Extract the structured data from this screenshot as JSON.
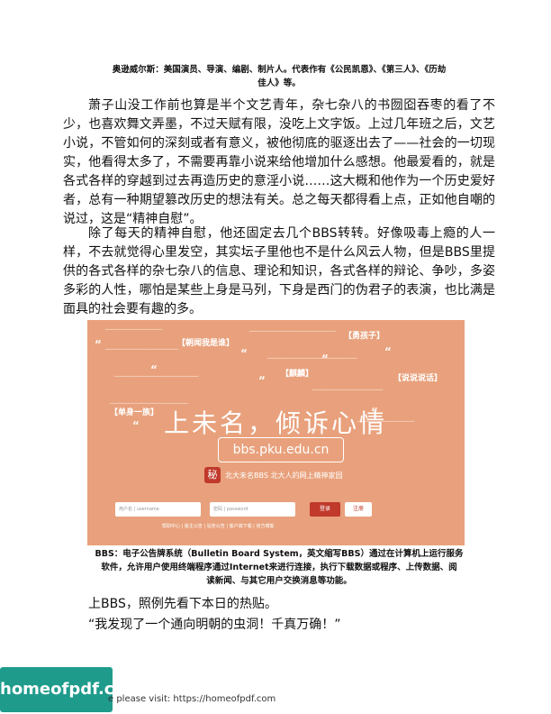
{
  "caption_top": {
    "line1": "奥逊威尔斯：美国演员、导演、编剧、制片人。代表作有《公民凯恩》、《第三人》、《历劫",
    "line2": "佳人》等。"
  },
  "paragraphs": [
    "萧子山没工作前也算是半个文艺青年，杂七杂八的书囫囵吞枣的看了不少，也喜欢舞文弄墨，不过天赋有限，没吃上文字饭。上过几年班之后，文艺小说，不管如何的深刻或者有意义，被他彻底的驱逐出去了——社会的一切现实，他看得太多了，不需要再靠小说来给他增加什么感想。他最爱看的，就是各式各样的穿越到过去再造历史的意淫小说……这大概和他作为一个历史爱好者，总有一种期望篡改历史的想法有关。总之每天都得看上点，正如他自嘲的说过，这是“精神自慰”。",
    "除了每天的精神自慰，他还固定去几个BBS转转。好像吸毒上瘾的人一样，不去就觉得心里发空，其实坛子里他也不是什么风云人物，但是BBS里提供的各式各样的杂七杂八的信息、理论和知识，各式各样的辩论、争吵，多姿多彩的人性，哪怕是某些上身是马列，下身是西门的伪君子的表演，也比满是面具的社会要有趣的多。"
  ],
  "banner": {
    "tags": [
      "【朝闻我是谁】",
      "【勇孩子】",
      "【麒麟】",
      "【说说说话】",
      "【单身一族】"
    ],
    "slogan": "上未名，倾诉心情",
    "url": "bbs.pku.edu.cn",
    "logo_char": "秘",
    "subtitle": "北大未名BBS 北大人的网上精神家园",
    "username_placeholder": "用户名 | username",
    "password_placeholder": "密码 | password",
    "login_label": "登录",
    "register_label": "注册",
    "links": "帮助中心 | 版主公告 | 站务公告 | 客户端下载 | 官方博客"
  },
  "caption_bottom": {
    "line1": "BBS：电子公告牌系统（Bulletin Board System，英文缩写BBS）通过在计算机上运行服务",
    "line2": "软件，允许用户使用终端程序通过Internet来进行连接，执行下载数据或程序、上传数据、阅",
    "line3": "读新闻、与其它用户交换消息等功能。"
  },
  "lines_after": {
    "line1": "上BBS，照例先看下本日的热贴。",
    "line2": "“我发现了一个通向明朝的虫洞！千真万确！”"
  },
  "footer": {
    "brand": "homeofpdf.com",
    "visit": "e please visit: https://homeofpdf.com"
  }
}
